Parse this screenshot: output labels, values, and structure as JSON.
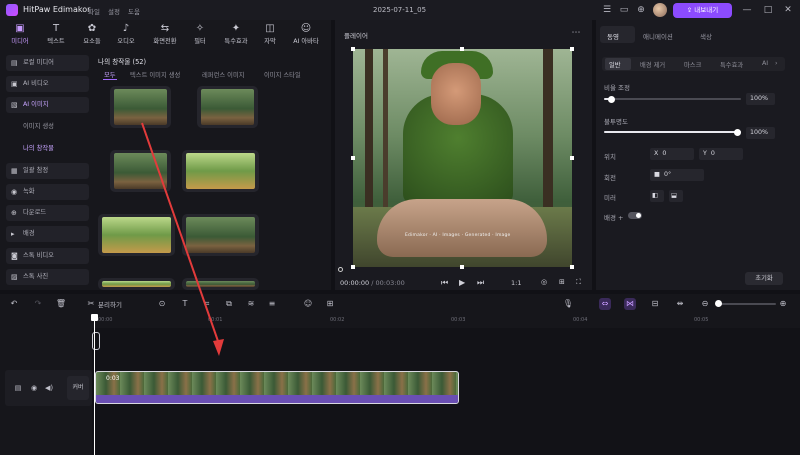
{
  "app": {
    "name": "HitPaw Edimakor",
    "menus": [
      "파일",
      "설정",
      "도움"
    ],
    "doc_title": "2025-07-11_05",
    "export_label": "내보내기",
    "accent": "#8c4bff"
  },
  "toolbar": {
    "tools": [
      {
        "icon": "media-icon",
        "glyph": "▣",
        "label": "미디어"
      },
      {
        "icon": "text-icon",
        "glyph": "T",
        "label": "텍스트"
      },
      {
        "icon": "elements-icon",
        "glyph": "✿",
        "label": "요소들"
      },
      {
        "icon": "audio-icon",
        "glyph": "♪",
        "label": "오디오"
      },
      {
        "icon": "transition-icon",
        "glyph": "⇆",
        "label": "화면전환"
      },
      {
        "icon": "filter-icon",
        "glyph": "✧",
        "label": "필터"
      },
      {
        "icon": "effects-icon",
        "glyph": "✦",
        "label": "특수효과"
      },
      {
        "icon": "subtitle-icon",
        "glyph": "◫",
        "label": "자막"
      },
      {
        "icon": "ai-avatar-icon",
        "glyph": "☺",
        "label": "AI 아바타"
      }
    ]
  },
  "sidebar": {
    "items": [
      "로컬 미디어",
      "AI 비디오",
      "AI 이미지",
      "이미지 생성",
      "나의 창작물",
      "일괄 참정",
      "녹화",
      "다운로드",
      "배경",
      "스톡 비디오",
      "스톡 사진"
    ]
  },
  "media": {
    "title": "나의 창작물 (52)",
    "filters": [
      "모두",
      "텍스트 이미지 생성",
      "레퍼런스 이미지",
      "이미지 스타일"
    ]
  },
  "preview": {
    "label": "플레이어",
    "watermark": "Edimakor · AI · Images · Generated · Image",
    "time_current": "00:00:00",
    "time_total": "/ 00:03:00",
    "zoom": "1:1"
  },
  "props": {
    "tabs": [
      "동영",
      "애니메이션",
      "색상"
    ],
    "subtabs": [
      "일반",
      "배경 제거",
      "마스크",
      "특수효과",
      "AI"
    ],
    "scale_label": "비율 조정",
    "scale_value": "100%",
    "scale_level": 0.05,
    "opacity_label": "불투명도",
    "opacity_value": "100%",
    "opacity_level": 1.0,
    "position_label": "위치",
    "pos_x_label": "X",
    "pos_x": "0",
    "pos_y_label": "Y",
    "pos_y": "0",
    "rotate_label": "회전",
    "rotate_value": "0°",
    "mirror_label": "미러",
    "blend_label": "배경 +",
    "reset_label": "초기화"
  },
  "timeline": {
    "split_label": "분리하기",
    "ticks": [
      "00:00",
      "00:01",
      "00:02",
      "00:03",
      "00:04",
      "00:05"
    ],
    "track_label": "커버",
    "clip_time": "0:03"
  }
}
